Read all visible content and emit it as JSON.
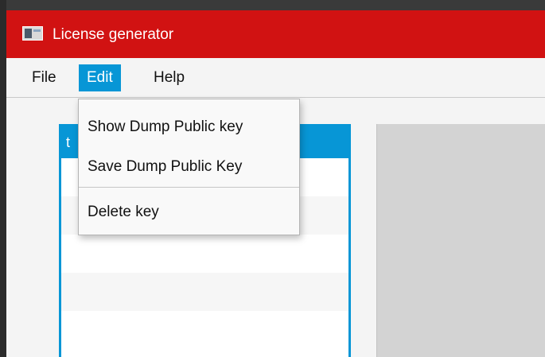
{
  "window": {
    "title": "License generator",
    "icon": "application-icon"
  },
  "menubar": {
    "items": [
      {
        "label": "File",
        "active": false
      },
      {
        "label": "Edit",
        "active": true
      },
      {
        "label": "Help",
        "active": false
      }
    ]
  },
  "edit_menu": {
    "items": [
      {
        "label": "Show Dump Public key"
      },
      {
        "label": "Save Dump Public Key"
      },
      {
        "label": "Delete key"
      }
    ]
  },
  "list": {
    "header_visible_text": "t"
  },
  "colors": {
    "titlebar": "#d11212",
    "accent": "#0796d6",
    "background": "#f4f4f4",
    "panel": "#d3d3d3"
  }
}
